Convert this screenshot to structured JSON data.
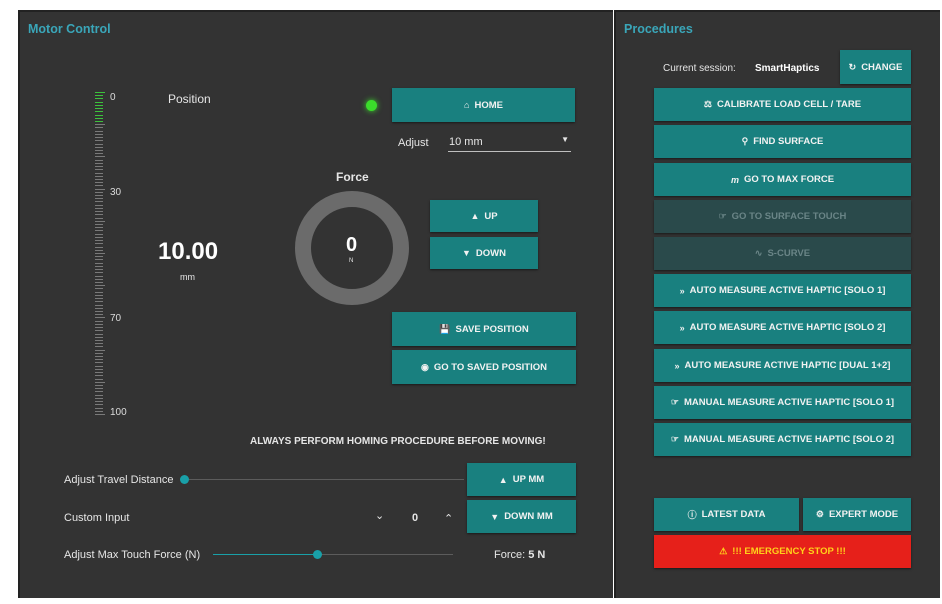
{
  "motor": {
    "title": "Motor Control",
    "position_label": "Position",
    "position_value": "10.00",
    "position_unit": "mm",
    "ruler_labels": [
      "0",
      "30",
      "70",
      "100"
    ],
    "ruler_fill_fraction": 0.1,
    "home_label": "HOME",
    "adjust_label": "Adjust",
    "adjust_value": "10 mm",
    "force_label": "Force",
    "force_value": "0",
    "force_unit": "N",
    "up_label": "UP",
    "down_label": "DOWN",
    "save_position_label": "SAVE POSITION",
    "goto_saved_label": "GO TO SAVED POSITION",
    "warning": "ALWAYS PERFORM HOMING PROCEDURE BEFORE MOVING!",
    "travel_label": "Adjust Travel Distance",
    "up_mm_label": "UP MM",
    "custom_input_label": "Custom Input",
    "custom_input_value": "0",
    "down_mm_label": "DOWN MM",
    "max_force_label": "Adjust Max Touch Force (N)",
    "force_readout_prefix": "Force:",
    "force_readout_value": "5 N",
    "colors": {
      "accent": "#19807f",
      "title": "#3aa6b9",
      "led": "#3bdc2b",
      "panel": "#333333"
    }
  },
  "procedures": {
    "title": "Procedures",
    "session_label": "Current session:",
    "session_value": "SmartHaptics",
    "change_label": "CHANGE",
    "buttons": [
      "CALIBRATE LOAD CELL / TARE",
      "FIND SURFACE",
      "GO TO MAX FORCE",
      "GO TO SURFACE TOUCH",
      "S-CURVE",
      "AUTO MEASURE ACTIVE HAPTIC [SOLO 1]",
      "AUTO MEASURE ACTIVE HAPTIC [SOLO 2]",
      "AUTO MEASURE ACTIVE HAPTIC [DUAL 1+2]",
      "MANUAL MEASURE ACTIVE HAPTIC [SOLO 1]",
      "MANUAL MEASURE ACTIVE HAPTIC [SOLO 2]"
    ],
    "latest_data_label": "LATEST DATA",
    "expert_mode_label": "EXPERT MODE",
    "emergency_label": "!!! EMERGENCY STOP !!!",
    "colors": {
      "danger": "#e6201a",
      "danger_text": "#ffd21a"
    }
  }
}
